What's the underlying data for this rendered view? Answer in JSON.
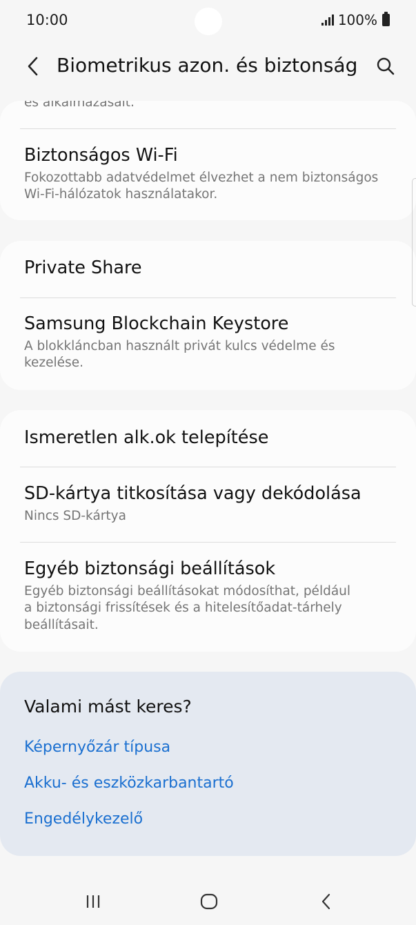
{
  "status_bar": {
    "time": "10:00",
    "battery": "100%",
    "signal_icon": "signal-bars-icon",
    "battery_icon": "battery-icon"
  },
  "header": {
    "title": "Biometrikus azon. és biztonság",
    "back_icon": "chevron-left-icon",
    "search_icon": "search-icon"
  },
  "card1": {
    "clipped_text": "és alkalmazásait.",
    "items": [
      {
        "title": "Biztonságos Wi-Fi",
        "subtitle": "Fokozottabb adatvédelmet élvezhet a nem biztonságos Wi-Fi-hálózatok használatakor."
      }
    ]
  },
  "card2": {
    "items": [
      {
        "title": "Private Share"
      },
      {
        "title": "Samsung Blockchain Keystore",
        "subtitle": "A blokkláncban használt privát kulcs védelme és kezelése."
      }
    ]
  },
  "card3": {
    "items": [
      {
        "title": "Ismeretlen alk.ok telepítése"
      },
      {
        "title": "SD-kártya titkosítása vagy dekódolása",
        "subtitle": "Nincs SD-kártya"
      },
      {
        "title": "Egyéb biztonsági beállítások",
        "subtitle": "Egyéb biztonsági beállításokat módosíthat, például a biztonsági frissítések és a hitelesítőadat-tárhely beállításait."
      }
    ]
  },
  "suggestions": {
    "title": "Valami mást keres?",
    "links": [
      "Képernyőzár típusa",
      "Akku- és eszközkarbantartó",
      "Engedélykezelő"
    ]
  },
  "nav_bar": {
    "recents_icon": "recents-icon",
    "home_icon": "home-icon",
    "back_icon": "back-icon"
  },
  "colors": {
    "background": "#f6f6f6",
    "card": "#fcfcfc",
    "suggest_card": "#e4e9f1",
    "link": "#1a6fd0",
    "secondary_text": "#757575"
  }
}
